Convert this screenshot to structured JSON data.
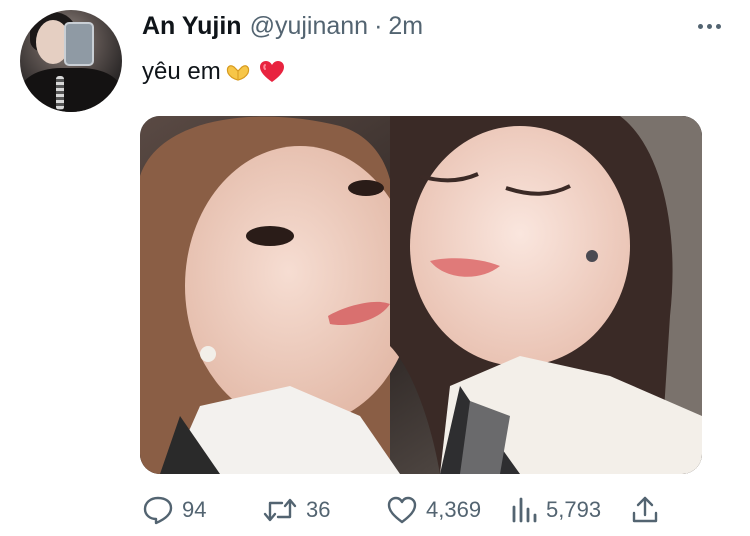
{
  "tweet": {
    "author_name": "An Yujin",
    "handle": "@yujinann",
    "separator": "·",
    "time": "2m",
    "text": "yêu em",
    "emojis": [
      "heart-hands-emoji",
      "red-heart-emoji"
    ]
  },
  "actions": {
    "reply_count": "94",
    "retweet_count": "36",
    "like_count": "4,369",
    "view_count": "5,793"
  },
  "colors": {
    "text_primary": "#0f1419",
    "text_secondary": "#536471",
    "heart_red": "#e0245e"
  }
}
